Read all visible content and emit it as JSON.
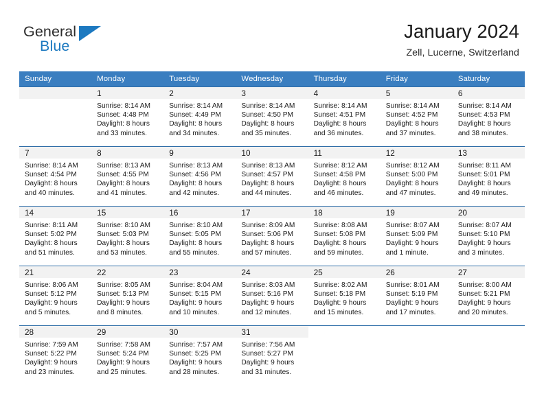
{
  "brand": {
    "word1": "General",
    "word2": "Blue",
    "accent_color": "#1c79c0",
    "logo_icon": "triangle-flag-icon"
  },
  "header": {
    "title": "January 2024",
    "subtitle": "Zell, Lucerne, Switzerland"
  },
  "calendar": {
    "header_bg": "#3a7ec0",
    "header_text_color": "#ffffff",
    "daynum_band_bg": "#f2f2f2",
    "row_divider_color": "#2f6ea8",
    "weekday_headers": [
      "Sunday",
      "Monday",
      "Tuesday",
      "Wednesday",
      "Thursday",
      "Friday",
      "Saturday"
    ],
    "weeks": [
      [
        {
          "day": "",
          "lines": []
        },
        {
          "day": "1",
          "lines": [
            "Sunrise: 8:14 AM",
            "Sunset: 4:48 PM",
            "Daylight: 8 hours",
            "and 33 minutes."
          ]
        },
        {
          "day": "2",
          "lines": [
            "Sunrise: 8:14 AM",
            "Sunset: 4:49 PM",
            "Daylight: 8 hours",
            "and 34 minutes."
          ]
        },
        {
          "day": "3",
          "lines": [
            "Sunrise: 8:14 AM",
            "Sunset: 4:50 PM",
            "Daylight: 8 hours",
            "and 35 minutes."
          ]
        },
        {
          "day": "4",
          "lines": [
            "Sunrise: 8:14 AM",
            "Sunset: 4:51 PM",
            "Daylight: 8 hours",
            "and 36 minutes."
          ]
        },
        {
          "day": "5",
          "lines": [
            "Sunrise: 8:14 AM",
            "Sunset: 4:52 PM",
            "Daylight: 8 hours",
            "and 37 minutes."
          ]
        },
        {
          "day": "6",
          "lines": [
            "Sunrise: 8:14 AM",
            "Sunset: 4:53 PM",
            "Daylight: 8 hours",
            "and 38 minutes."
          ]
        }
      ],
      [
        {
          "day": "7",
          "lines": [
            "Sunrise: 8:14 AM",
            "Sunset: 4:54 PM",
            "Daylight: 8 hours",
            "and 40 minutes."
          ]
        },
        {
          "day": "8",
          "lines": [
            "Sunrise: 8:13 AM",
            "Sunset: 4:55 PM",
            "Daylight: 8 hours",
            "and 41 minutes."
          ]
        },
        {
          "day": "9",
          "lines": [
            "Sunrise: 8:13 AM",
            "Sunset: 4:56 PM",
            "Daylight: 8 hours",
            "and 42 minutes."
          ]
        },
        {
          "day": "10",
          "lines": [
            "Sunrise: 8:13 AM",
            "Sunset: 4:57 PM",
            "Daylight: 8 hours",
            "and 44 minutes."
          ]
        },
        {
          "day": "11",
          "lines": [
            "Sunrise: 8:12 AM",
            "Sunset: 4:58 PM",
            "Daylight: 8 hours",
            "and 46 minutes."
          ]
        },
        {
          "day": "12",
          "lines": [
            "Sunrise: 8:12 AM",
            "Sunset: 5:00 PM",
            "Daylight: 8 hours",
            "and 47 minutes."
          ]
        },
        {
          "day": "13",
          "lines": [
            "Sunrise: 8:11 AM",
            "Sunset: 5:01 PM",
            "Daylight: 8 hours",
            "and 49 minutes."
          ]
        }
      ],
      [
        {
          "day": "14",
          "lines": [
            "Sunrise: 8:11 AM",
            "Sunset: 5:02 PM",
            "Daylight: 8 hours",
            "and 51 minutes."
          ]
        },
        {
          "day": "15",
          "lines": [
            "Sunrise: 8:10 AM",
            "Sunset: 5:03 PM",
            "Daylight: 8 hours",
            "and 53 minutes."
          ]
        },
        {
          "day": "16",
          "lines": [
            "Sunrise: 8:10 AM",
            "Sunset: 5:05 PM",
            "Daylight: 8 hours",
            "and 55 minutes."
          ]
        },
        {
          "day": "17",
          "lines": [
            "Sunrise: 8:09 AM",
            "Sunset: 5:06 PM",
            "Daylight: 8 hours",
            "and 57 minutes."
          ]
        },
        {
          "day": "18",
          "lines": [
            "Sunrise: 8:08 AM",
            "Sunset: 5:08 PM",
            "Daylight: 8 hours",
            "and 59 minutes."
          ]
        },
        {
          "day": "19",
          "lines": [
            "Sunrise: 8:07 AM",
            "Sunset: 5:09 PM",
            "Daylight: 9 hours",
            "and 1 minute."
          ]
        },
        {
          "day": "20",
          "lines": [
            "Sunrise: 8:07 AM",
            "Sunset: 5:10 PM",
            "Daylight: 9 hours",
            "and 3 minutes."
          ]
        }
      ],
      [
        {
          "day": "21",
          "lines": [
            "Sunrise: 8:06 AM",
            "Sunset: 5:12 PM",
            "Daylight: 9 hours",
            "and 5 minutes."
          ]
        },
        {
          "day": "22",
          "lines": [
            "Sunrise: 8:05 AM",
            "Sunset: 5:13 PM",
            "Daylight: 9 hours",
            "and 8 minutes."
          ]
        },
        {
          "day": "23",
          "lines": [
            "Sunrise: 8:04 AM",
            "Sunset: 5:15 PM",
            "Daylight: 9 hours",
            "and 10 minutes."
          ]
        },
        {
          "day": "24",
          "lines": [
            "Sunrise: 8:03 AM",
            "Sunset: 5:16 PM",
            "Daylight: 9 hours",
            "and 12 minutes."
          ]
        },
        {
          "day": "25",
          "lines": [
            "Sunrise: 8:02 AM",
            "Sunset: 5:18 PM",
            "Daylight: 9 hours",
            "and 15 minutes."
          ]
        },
        {
          "day": "26",
          "lines": [
            "Sunrise: 8:01 AM",
            "Sunset: 5:19 PM",
            "Daylight: 9 hours",
            "and 17 minutes."
          ]
        },
        {
          "day": "27",
          "lines": [
            "Sunrise: 8:00 AM",
            "Sunset: 5:21 PM",
            "Daylight: 9 hours",
            "and 20 minutes."
          ]
        }
      ],
      [
        {
          "day": "28",
          "lines": [
            "Sunrise: 7:59 AM",
            "Sunset: 5:22 PM",
            "Daylight: 9 hours",
            "and 23 minutes."
          ]
        },
        {
          "day": "29",
          "lines": [
            "Sunrise: 7:58 AM",
            "Sunset: 5:24 PM",
            "Daylight: 9 hours",
            "and 25 minutes."
          ]
        },
        {
          "day": "30",
          "lines": [
            "Sunrise: 7:57 AM",
            "Sunset: 5:25 PM",
            "Daylight: 9 hours",
            "and 28 minutes."
          ]
        },
        {
          "day": "31",
          "lines": [
            "Sunrise: 7:56 AM",
            "Sunset: 5:27 PM",
            "Daylight: 9 hours",
            "and 31 minutes."
          ]
        },
        {
          "day": "",
          "lines": []
        },
        {
          "day": "",
          "lines": []
        },
        {
          "day": "",
          "lines": []
        }
      ]
    ]
  }
}
